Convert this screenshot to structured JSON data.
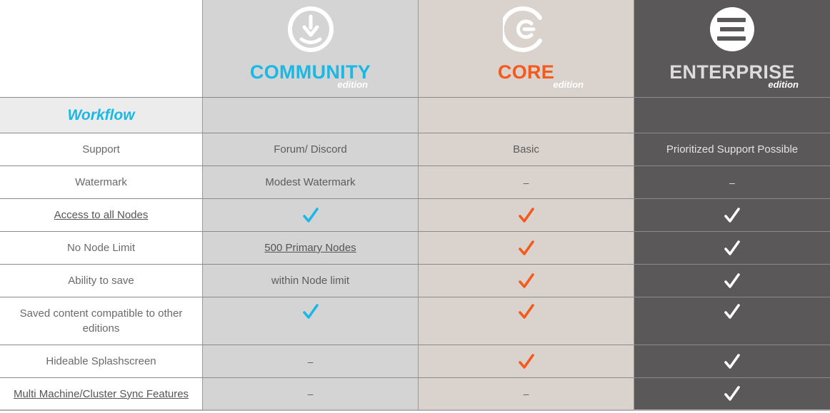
{
  "editions": {
    "community": {
      "name": "COMMUNITY",
      "sub": "edition",
      "color": "#1ab8e4",
      "icon": "community-download-logo-icon"
    },
    "core": {
      "name": "CORE",
      "sub": "edition",
      "color": "#f35a1c",
      "icon": "core-logo-icon"
    },
    "enterprise": {
      "name": "ENTERPRISE",
      "sub": "edition",
      "color": "#dcdcdc",
      "icon": "enterprise-logo-icon"
    }
  },
  "section": {
    "label": "Workflow"
  },
  "rows": {
    "support": {
      "label": "Support",
      "community": "Forum/ Discord",
      "core": "Basic",
      "enterprise": "Prioritized Support Possible"
    },
    "watermark": {
      "label": "Watermark",
      "community": "Modest Watermark",
      "core": "–",
      "enterprise": "–"
    },
    "access_nodes": {
      "label": "Access to all Nodes"
    },
    "node_limit": {
      "label": "No Node Limit",
      "community": "500 Primary Nodes"
    },
    "save": {
      "label": "Ability to save",
      "community": "within Node limit"
    },
    "compat": {
      "label": "Saved content compatible to other editions"
    },
    "splash": {
      "label": "Hideable Splashscreen",
      "community": "–"
    },
    "cluster": {
      "label": "Multi Machine/Cluster Sync Features",
      "community": "–",
      "core": "–"
    }
  },
  "colors": {
    "community_bg": "#d4d4d4",
    "core_bg": "#dad2cd",
    "enterprise_bg": "#5a5858",
    "check_community": "#1ab8e4",
    "check_core": "#f35a1c",
    "check_enterprise": "#ffffff"
  }
}
